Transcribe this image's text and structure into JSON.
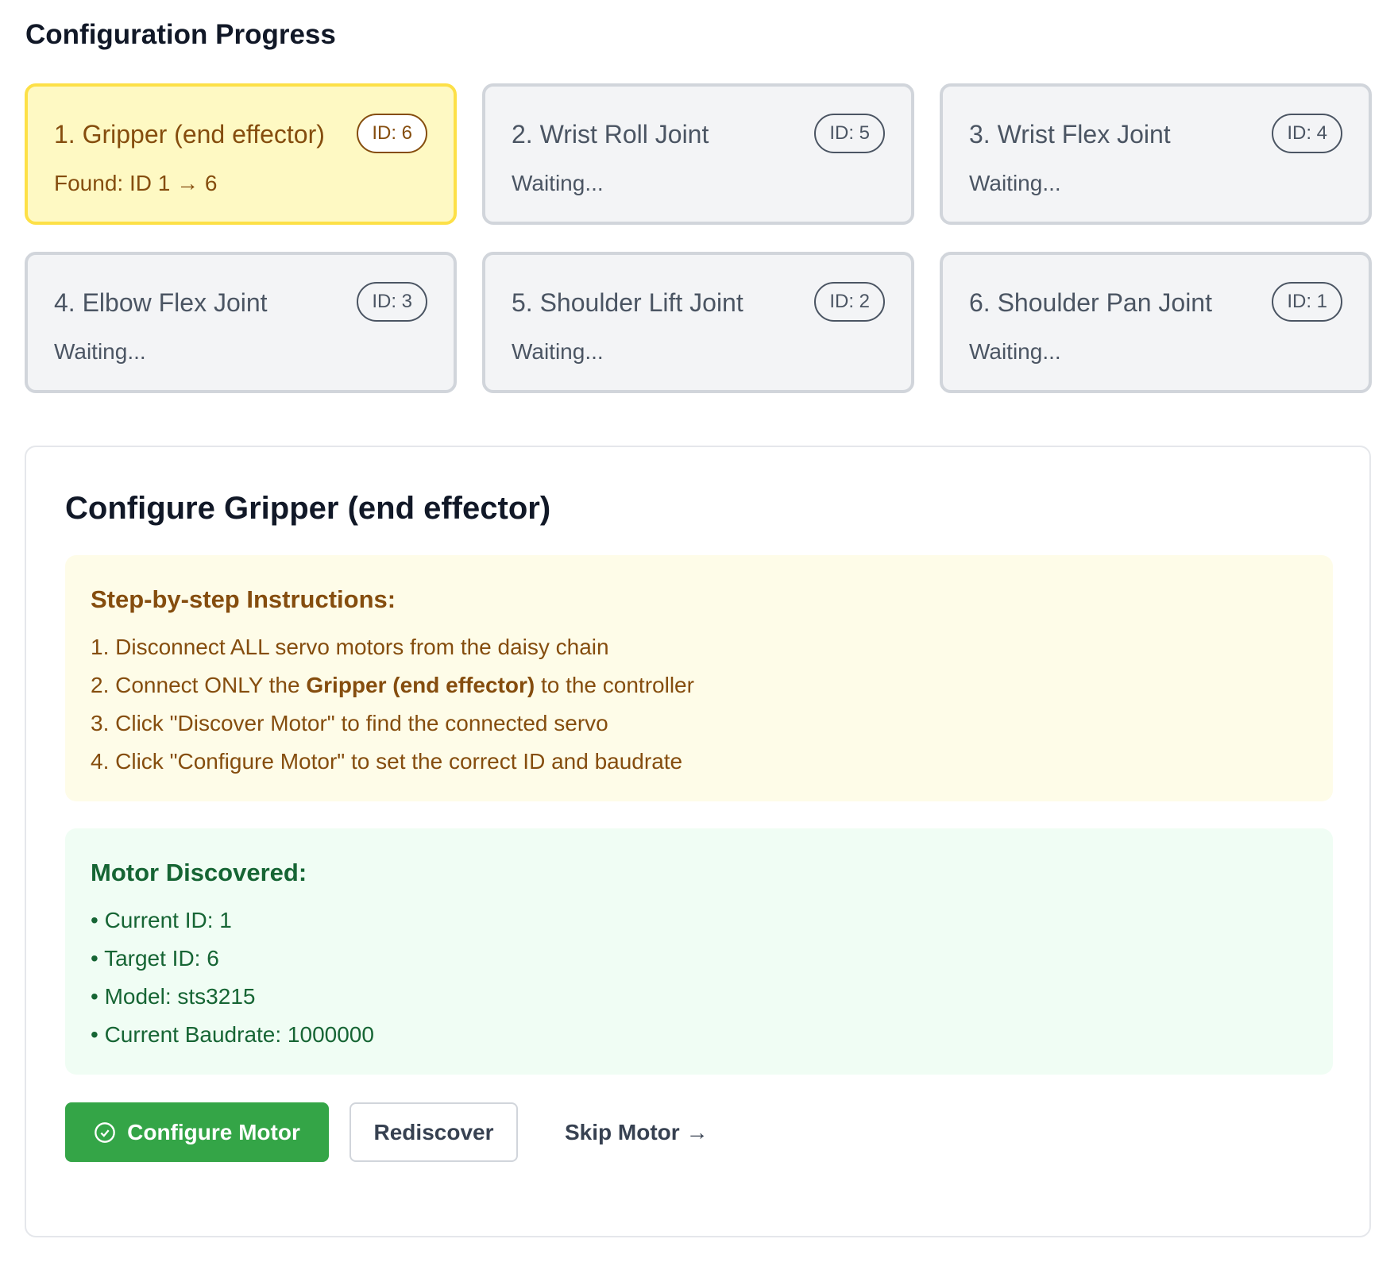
{
  "header": {
    "title": "Configuration Progress"
  },
  "motors": [
    {
      "title": "1. Gripper (end effector)",
      "badge": "ID: 6",
      "status": "Found: ID 1 → 6",
      "active": true
    },
    {
      "title": "2. Wrist Roll Joint",
      "badge": "ID: 5",
      "status": "Waiting..."
    },
    {
      "title": "3. Wrist Flex Joint",
      "badge": "ID: 4",
      "status": "Waiting..."
    },
    {
      "title": "4. Elbow Flex Joint",
      "badge": "ID: 3",
      "status": "Waiting..."
    },
    {
      "title": "5. Shoulder Lift Joint",
      "badge": "ID: 2",
      "status": "Waiting..."
    },
    {
      "title": "6. Shoulder Pan Joint",
      "badge": "ID: 1",
      "status": "Waiting..."
    }
  ],
  "panel": {
    "title": "Configure Gripper (end effector)",
    "instructions": {
      "heading": "Step-by-step Instructions:",
      "step1": "1. Disconnect ALL servo motors from the daisy chain",
      "step2_pre": "2. Connect ONLY the ",
      "step2_bold": "Gripper (end effector)",
      "step2_post": " to the controller",
      "step3": "3. Click \"Discover Motor\" to find the connected servo",
      "step4": "4. Click \"Configure Motor\" to set the correct ID and baudrate"
    },
    "discovered": {
      "heading": "Motor Discovered:",
      "items": [
        "• Current ID: 1",
        "• Target ID: 6",
        "• Model: sts3215",
        "• Current Baudrate: 1000000"
      ]
    },
    "buttons": {
      "configure": "Configure Motor",
      "configure_icon": "check-circle-icon",
      "rediscover": "Rediscover",
      "skip": "Skip Motor →"
    }
  },
  "colors": {
    "active_bg": "#fef9c3",
    "active_border": "#fde047",
    "primary": "#34a547"
  }
}
